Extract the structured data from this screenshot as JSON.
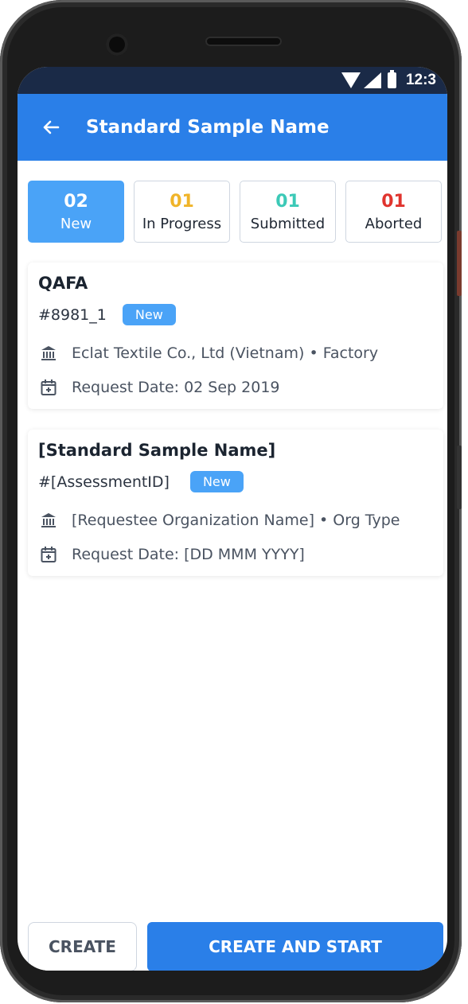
{
  "status_bar": {
    "time": "12:3"
  },
  "appbar": {
    "title": "Standard Sample Name"
  },
  "tabs": [
    {
      "count": "02",
      "label": "New",
      "color": "#ffffff",
      "active": true
    },
    {
      "count": "01",
      "label": "In Progress",
      "color": "#f0b429",
      "active": false
    },
    {
      "count": "01",
      "label": "Submitted",
      "color": "#3cc9b7",
      "active": false
    },
    {
      "count": "01",
      "label": "Aborted",
      "color": "#e0342e",
      "active": false
    }
  ],
  "cards": [
    {
      "title": "QAFA",
      "id": "#8981_1",
      "badge": "New",
      "organization": "Eclat Textile Co., Ltd (Vietnam) • Factory",
      "request_date": "Request Date: 02 Sep 2019"
    },
    {
      "title": "[Standard Sample Name]",
      "id": "#[AssessmentID]",
      "badge": "New",
      "organization": "[Requestee Organization Name] • Org Type",
      "request_date": "Request Date: [DD MMM YYYY]"
    }
  ],
  "actions": {
    "create": "CREATE",
    "create_and_start": "CREATE AND START"
  },
  "colors": {
    "primary": "#2a7fe8",
    "badge": "#4aa3f7",
    "status_bar": "#1a2a47"
  }
}
